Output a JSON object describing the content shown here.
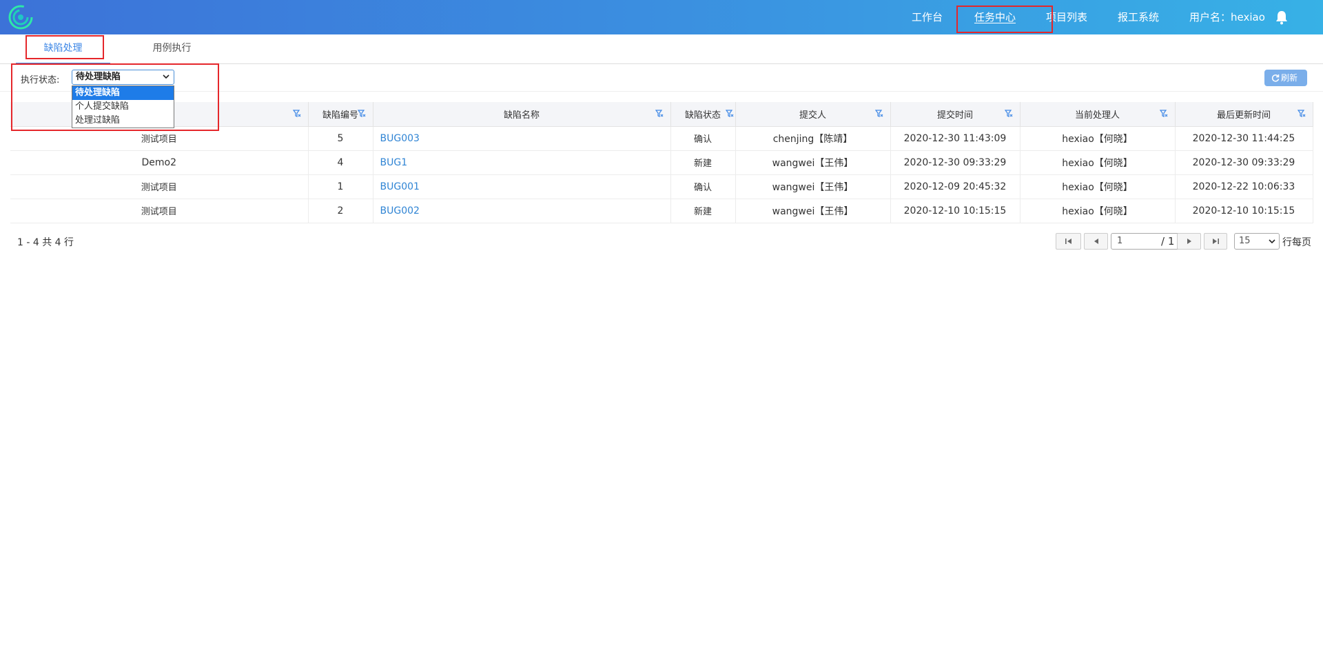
{
  "header": {
    "nav": [
      {
        "label": "工作台"
      },
      {
        "label": "任务中心"
      },
      {
        "label": "项目列表"
      },
      {
        "label": "报工系统"
      }
    ],
    "user_label": "用户名：hexiao"
  },
  "tabs": [
    {
      "label": "缺陷处理"
    },
    {
      "label": "用例执行"
    }
  ],
  "toolbar": {
    "status_label": "执行状态:",
    "status_value": "待处理缺陷",
    "status_options": [
      "待处理缺陷",
      "个人提交缺陷",
      "处理过缺陷"
    ],
    "refresh_label": "刷新"
  },
  "table": {
    "columns": [
      "",
      "缺陷编号",
      "缺陷名称",
      "缺陷状态",
      "提交人",
      "提交时间",
      "当前处理人",
      "最后更新时间"
    ],
    "rows": [
      [
        "测试项目",
        "5",
        "BUG003",
        "确认",
        "chenjing【陈靖】",
        "2020-12-30 11:43:09",
        "hexiao【何晓】",
        "2020-12-30 11:44:25"
      ],
      [
        "Demo2",
        "4",
        "BUG1",
        "新建",
        "wangwei【王伟】",
        "2020-12-30 09:33:29",
        "hexiao【何晓】",
        "2020-12-30 09:33:29"
      ],
      [
        "测试项目",
        "1",
        "BUG001",
        "确认",
        "wangwei【王伟】",
        "2020-12-09 20:45:32",
        "hexiao【何晓】",
        "2020-12-22 10:06:33"
      ],
      [
        "测试项目",
        "2",
        "BUG002",
        "新建",
        "wangwei【王伟】",
        "2020-12-10 10:15:15",
        "hexiao【何晓】",
        "2020-12-10 10:15:15"
      ]
    ]
  },
  "footer": {
    "page_info": "1 - 4 共 4 行",
    "page_input": "1",
    "page_total": "/ 1",
    "per_page": "15",
    "per_page_label": "行每页"
  },
  "colors": {
    "header_start": "#3c72d8",
    "header_end": "#37b1e6",
    "accent": "#3d87e6",
    "link": "#2f84d4",
    "highlight": "#e5262a"
  }
}
